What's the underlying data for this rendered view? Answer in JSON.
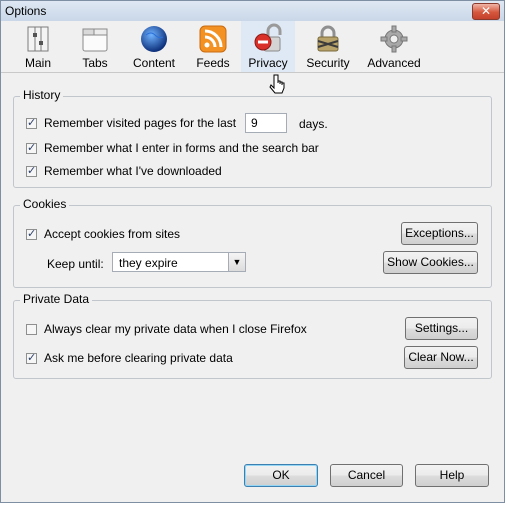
{
  "window": {
    "title": "Options"
  },
  "panes": [
    {
      "label": "Main",
      "icon": "main-icon"
    },
    {
      "label": "Tabs",
      "icon": "tabs-icon"
    },
    {
      "label": "Content",
      "icon": "content-globe-icon"
    },
    {
      "label": "Feeds",
      "icon": "feeds-rss-icon"
    },
    {
      "label": "Privacy",
      "icon": "privacy-lock-icon",
      "selected": true
    },
    {
      "label": "Security",
      "icon": "security-padlock-icon"
    },
    {
      "label": "Advanced",
      "icon": "advanced-gear-icon"
    }
  ],
  "history": {
    "legend": "History",
    "remember_pages_prefix": "Remember visited pages for the last",
    "remember_pages_value": "9",
    "remember_pages_suffix": "days.",
    "remember_forms": "Remember what I enter in forms and the search bar",
    "remember_downloads": "Remember what I've downloaded"
  },
  "cookies": {
    "legend": "Cookies",
    "accept": "Accept cookies from sites",
    "exceptions_button": "Exceptions...",
    "keep_until_label": "Keep until:",
    "keep_until_value": "they expire",
    "show_cookies_button": "Show Cookies..."
  },
  "private_data": {
    "legend": "Private Data",
    "always_clear": "Always clear my private data when I close Firefox",
    "settings_button": "Settings...",
    "ask_before": "Ask me before clearing private data",
    "clear_now_button": "Clear Now..."
  },
  "footer": {
    "ok": "OK",
    "cancel": "Cancel",
    "help": "Help"
  },
  "colors": {
    "selected_pane": "#dfe9f5",
    "close_red": "#c4402a",
    "default_button_border": "#3c7fb1"
  }
}
